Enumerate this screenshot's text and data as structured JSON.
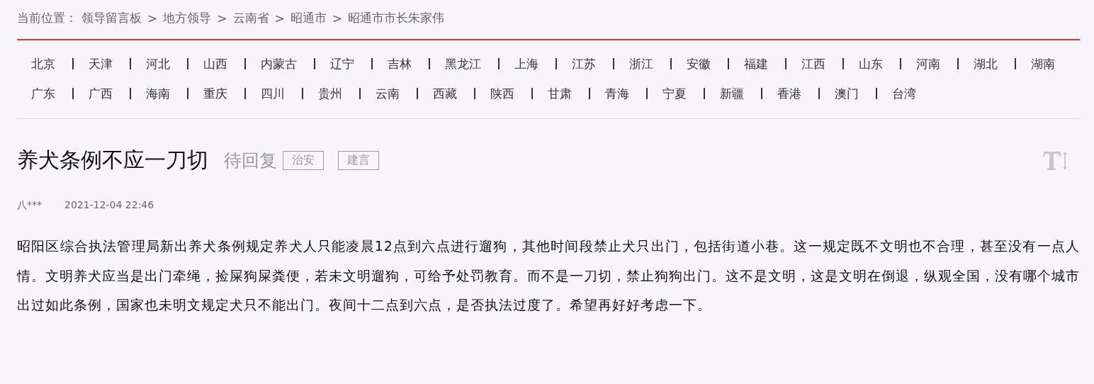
{
  "breadcrumb": {
    "label": "当前位置：",
    "items": [
      "领导留言板",
      "地方领导",
      "云南省",
      "昭通市",
      "昭通市市长朱家伟"
    ],
    "separator": ">"
  },
  "province_rows": [
    [
      "北京",
      "天津",
      "河北",
      "山西",
      "内蒙古",
      "辽宁",
      "吉林",
      "黑龙江",
      "上海",
      "江苏",
      "浙江",
      "安徽",
      "福建",
      "江西",
      "山东",
      "河南",
      "湖北",
      "湖南"
    ],
    [
      "广东",
      "广西",
      "海南",
      "重庆",
      "四川",
      "贵州",
      "云南",
      "西藏",
      "陕西",
      "甘肃",
      "青海",
      "宁夏",
      "新疆",
      "香港",
      "澳门",
      "台湾"
    ]
  ],
  "message": {
    "title": "养犬条例不应一刀切",
    "status": "待回复",
    "tags": [
      "治安",
      "建言"
    ],
    "author": "八***",
    "time": "2021-12-04 22:46",
    "body": "昭阳区综合执法管理局新出养犬条例规定养犬人只能凌晨12点到六点进行遛狗，其他时间段禁止犬只出门，包括街道小巷。这一规定既不文明也不合理，甚至没有一点人情。文明养犬应当是出门牵绳，捡屎狗屎粪便，若未文明遛狗，可给予处罚教育。而不是一刀切，禁止狗狗出门。这不是文明，这是文明在倒退，纵观全国，没有哪个城市出过如此条例，国家也未明文规定犬只不能出门。夜间十二点到六点，是否执法过度了。希望再好好考虑一下。"
  }
}
